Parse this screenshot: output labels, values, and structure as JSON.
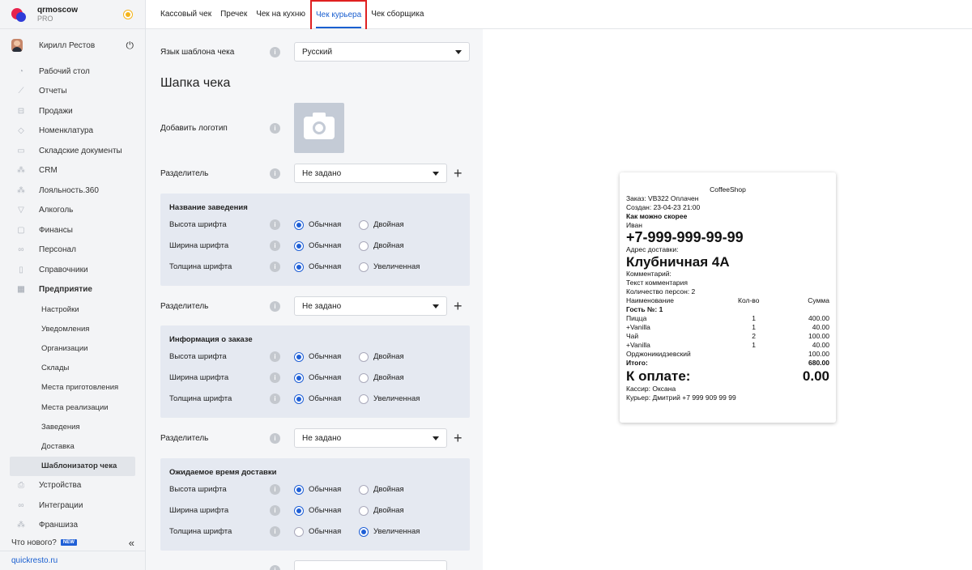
{
  "brand": {
    "name": "qrmoscow",
    "plan": "PRO"
  },
  "user": {
    "name": "Кирилл Рестов"
  },
  "nav": {
    "items": [
      {
        "label": "Рабочий стол",
        "icon": "dashboard-icon"
      },
      {
        "label": "Отчеты",
        "icon": "chart-icon"
      },
      {
        "label": "Продажи",
        "icon": "basket-icon"
      },
      {
        "label": "Номенклатура",
        "icon": "tag-icon"
      },
      {
        "label": "Складские документы",
        "icon": "box-icon"
      },
      {
        "label": "CRM",
        "icon": "users-icon"
      },
      {
        "label": "Лояльность.360",
        "icon": "loyalty-icon"
      },
      {
        "label": "Алкоголь",
        "icon": "glass-icon"
      },
      {
        "label": "Финансы",
        "icon": "wallet-icon"
      },
      {
        "label": "Персонал",
        "icon": "staff-icon"
      },
      {
        "label": "Справочники",
        "icon": "book-icon"
      },
      {
        "label": "Предприятие",
        "icon": "building-icon"
      }
    ],
    "sub_items": [
      "Настройки",
      "Уведомления",
      "Организации",
      "Склады",
      "Места приготовления",
      "Места реализации",
      "Заведения",
      "Доставка",
      "Шаблонизатор чека"
    ],
    "bottom_items": [
      {
        "label": "Устройства",
        "icon": "printer-icon"
      },
      {
        "label": "Интеграции",
        "icon": "link-icon"
      },
      {
        "label": "Франшиза",
        "icon": "franchise-icon"
      }
    ],
    "whats_new": "Что нового?",
    "new_badge": "NEW",
    "collapse": "«",
    "site": "quickresto.ru"
  },
  "tabs": [
    "Кассовый чек",
    "Пречек",
    "Чек на кухню",
    "Чек курьера",
    "Чек сборщика"
  ],
  "form": {
    "language_label": "Язык шаблона чека",
    "language_value": "Русский",
    "header_title": "Шапка чека",
    "add_logo_label": "Добавить логотип",
    "divider_label": "Разделитель",
    "divider_value": "Не задано",
    "font_height": "Высота шрифта",
    "font_width": "Ширина шрифта",
    "font_weight": "Толщина шрифта",
    "normal": "Обычная",
    "double": "Двойная",
    "bold": "Увеличенная",
    "groups": [
      "Название заведения",
      "Информация о заказе",
      "Ожидаемое время доставки"
    ]
  },
  "receipt": {
    "shop": "CoffeeShop",
    "order": "Заказ: VB322 Оплачен",
    "created": "Создан: 23-04-23 21:00",
    "asap": "Как можно скорее",
    "client": "Иван",
    "phone": "+7-999-999-99-99",
    "address_label": "Адрес доставки:",
    "street": "Клубничная 4А",
    "comment_label": "Комментарий:",
    "comment": "Текст комментария",
    "persons": "Количество персон: 2",
    "col_name": "Наименование",
    "col_qty": "Кол-во",
    "col_sum": "Сумма",
    "guest": "Гость №: 1",
    "items": [
      {
        "name": "Пицца",
        "qty": "1",
        "sum": "400.00"
      },
      {
        "name": "+Vanilla",
        "qty": "1",
        "sum": "40.00"
      },
      {
        "name": "Чай",
        "qty": "2",
        "sum": "100.00"
      },
      {
        "name": "+Vanilla",
        "qty": "1",
        "sum": "40.00"
      },
      {
        "name": "Орджоникидзевский",
        "qty": "",
        "sum": "100.00"
      }
    ],
    "total_label": "Итого:",
    "total": "680.00",
    "pay_label": "К оплате:",
    "pay": "0.00",
    "cashier": "Кассир: Оксана",
    "courier": "Курьер: Дмитрий +7 999 909 99 99"
  },
  "colors": {
    "accent": "#1a5fd0",
    "highlight": "#e02020",
    "panel": "#f5f6f8",
    "group": "#e5e9f1"
  }
}
